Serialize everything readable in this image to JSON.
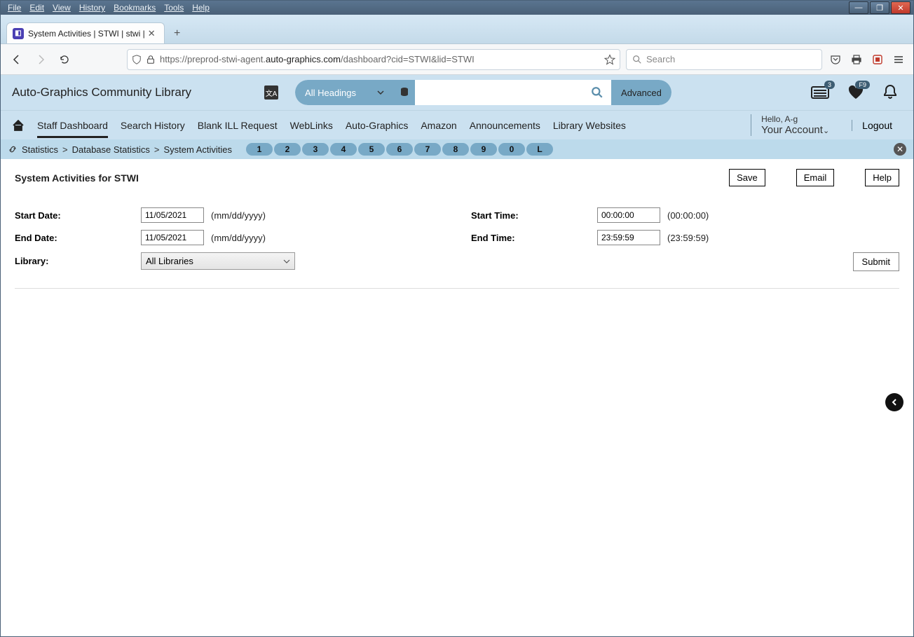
{
  "browser": {
    "menus": [
      "File",
      "Edit",
      "View",
      "History",
      "Bookmarks",
      "Tools",
      "Help"
    ],
    "tab_title": "System Activities | STWI | stwi | ",
    "url_prefix": "https://preprod-stwi-agent.",
    "url_domain": "auto-graphics.com",
    "url_path": "/dashboard?cid=STWI&lid=STWI",
    "search_placeholder": "Search"
  },
  "header": {
    "library_name": "Auto-Graphics Community Library",
    "search_scope": "All Headings",
    "advanced_label": "Advanced",
    "list_badge": "3",
    "fav_badge": "F9"
  },
  "nav": {
    "items": [
      "Staff Dashboard",
      "Search History",
      "Blank ILL Request",
      "WebLinks",
      "Auto-Graphics",
      "Amazon",
      "Announcements",
      "Library Websites"
    ],
    "hello": "Hello, A-g",
    "account": "Your Account",
    "logout": "Logout"
  },
  "crumb": {
    "c1": "Statistics",
    "c2": "Database Statistics",
    "c3": "System Activities",
    "pages": [
      "1",
      "2",
      "3",
      "4",
      "5",
      "6",
      "7",
      "8",
      "9",
      "0",
      "L"
    ]
  },
  "page": {
    "title": "System Activities for STWI",
    "save": "Save",
    "email": "Email",
    "help": "Help",
    "start_date_label": "Start Date:",
    "start_date_value": "11/05/2021",
    "date_hint": "(mm/dd/yyyy)",
    "end_date_label": "End Date:",
    "end_date_value": "11/05/2021",
    "start_time_label": "Start Time:",
    "start_time_value": "00:00:00",
    "start_time_hint": "(00:00:00)",
    "end_time_label": "End Time:",
    "end_time_value": "23:59:59",
    "end_time_hint": "(23:59:59)",
    "library_label": "Library:",
    "library_value": "All Libraries",
    "submit": "Submit"
  }
}
